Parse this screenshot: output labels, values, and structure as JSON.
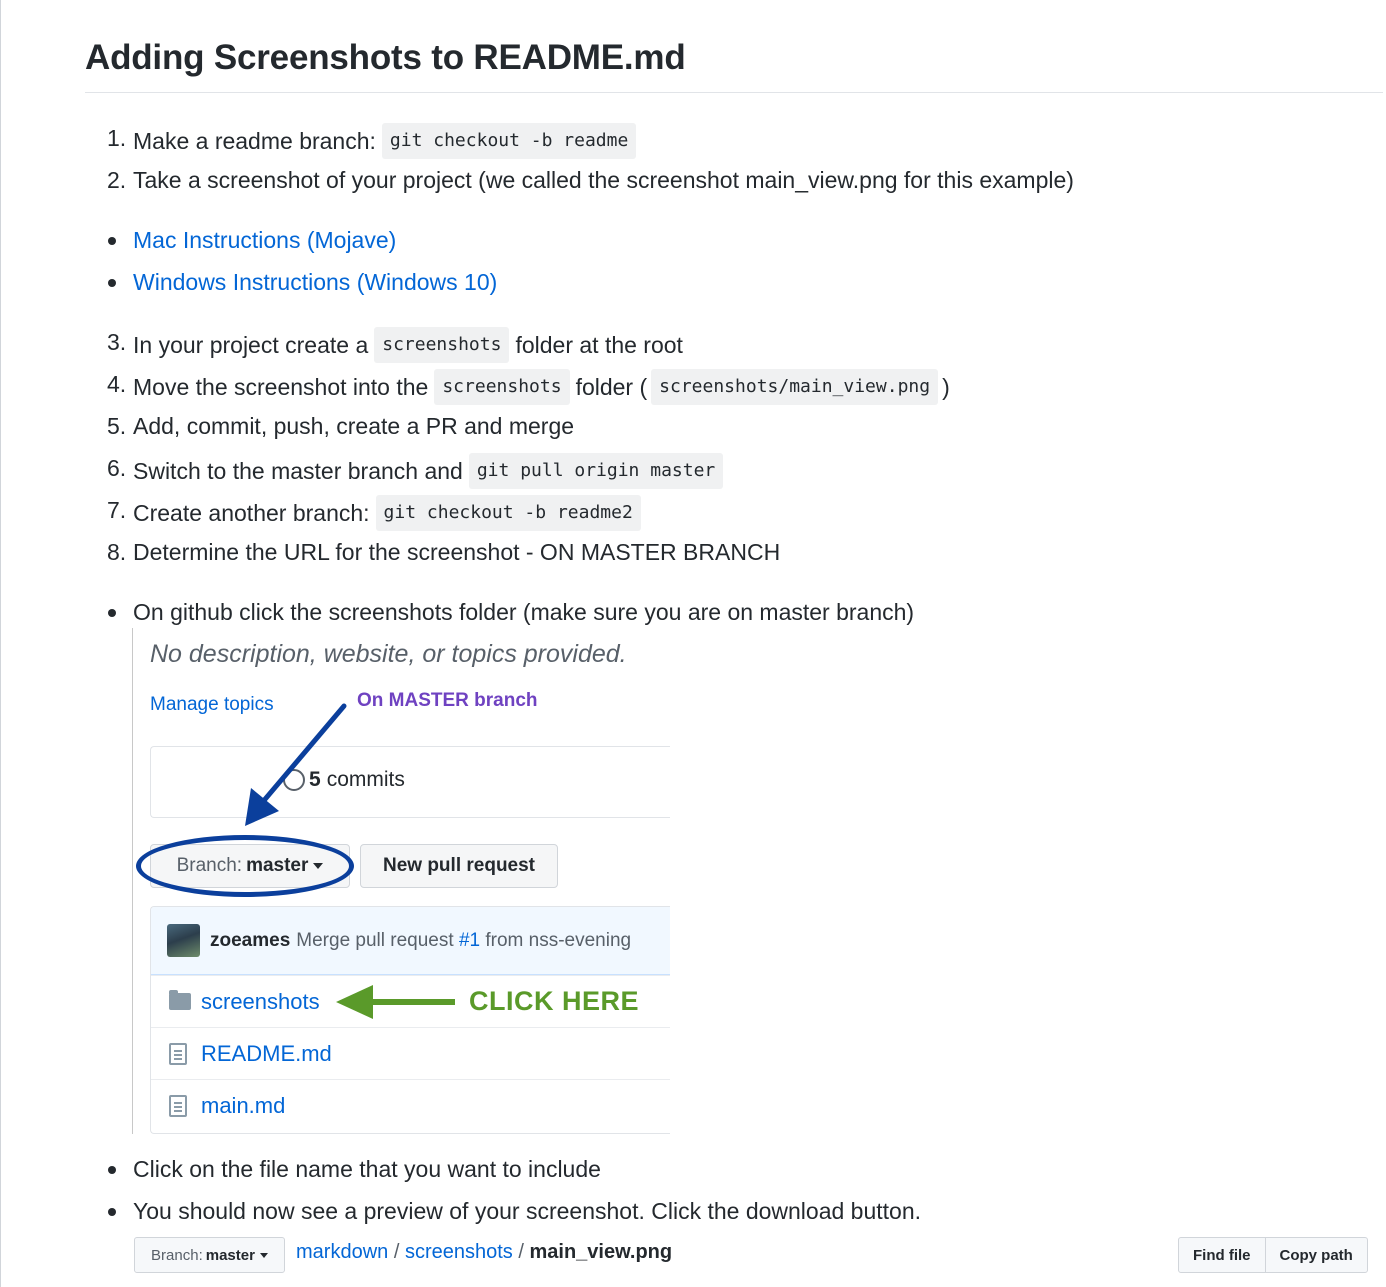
{
  "heading": "Adding Screenshots to README.md",
  "steps_a": [
    {
      "num": "1.",
      "text": "Make a readme branch:",
      "code": "git checkout -b readme"
    },
    {
      "num": "2.",
      "text": "Take a screenshot of your project (we called the screenshot main_view.png for this example)"
    }
  ],
  "links": [
    {
      "label": "Mac Instructions (Mojave)"
    },
    {
      "label": "Windows Instructions (Windows 10)"
    }
  ],
  "steps_b": {
    "s3": {
      "num": "3.",
      "before": "In your project create a",
      "code": "screenshots",
      "after": "folder at the root"
    },
    "s4": {
      "num": "4.",
      "before": "Move the screenshot into the",
      "code": "screenshots",
      "mid": "folder (",
      "code2": "screenshots/main_view.png",
      "after": ")"
    },
    "s5": {
      "num": "5.",
      "text": "Add, commit, push, create a PR and merge"
    },
    "s6": {
      "num": "6.",
      "before": "Switch to the master branch and",
      "code": "git pull origin master"
    },
    "s7": {
      "num": "7.",
      "before": "Create another branch:",
      "code": "git checkout -b readme2"
    },
    "s8": {
      "num": "8.",
      "text": "Determine the URL for the screenshot - ON MASTER BRANCH"
    }
  },
  "bullets": {
    "b1": "On github click the screenshots folder (make sure you are on master branch)",
    "b2": "Click on the file name that you want to include",
    "b3": "You should now see a preview of your screenshot. Click the download button."
  },
  "screenshot": {
    "description": "No description, website, or topics provided.",
    "manage_topics": "Manage topics",
    "master_note": "On MASTER branch",
    "commits_count": "5",
    "commits_label": "commits",
    "branch_label": "Branch:",
    "branch_value": "master",
    "new_pr": "New pull request",
    "commit_user": "zoeames",
    "commit_msg": "Merge pull request",
    "commit_pr": "#1",
    "commit_from": "from nss-evening",
    "files": [
      "screenshots",
      "README.md",
      "main.md"
    ],
    "click_here": "CLICK HERE",
    "colors": {
      "arrow_blue": "#0b3f9c",
      "arrow_green": "#5a9a2a",
      "note_purple": "#6f42c1"
    }
  },
  "file_bar": {
    "branch_label": "Branch:",
    "branch_value": "master",
    "crumbs": [
      "markdown",
      "screenshots"
    ],
    "current": "main_view.png",
    "find_file": "Find file",
    "copy_path": "Copy path"
  },
  "colors": {
    "link": "#0366d6",
    "text": "#24292e",
    "code_bg": "#f0f1f2"
  }
}
